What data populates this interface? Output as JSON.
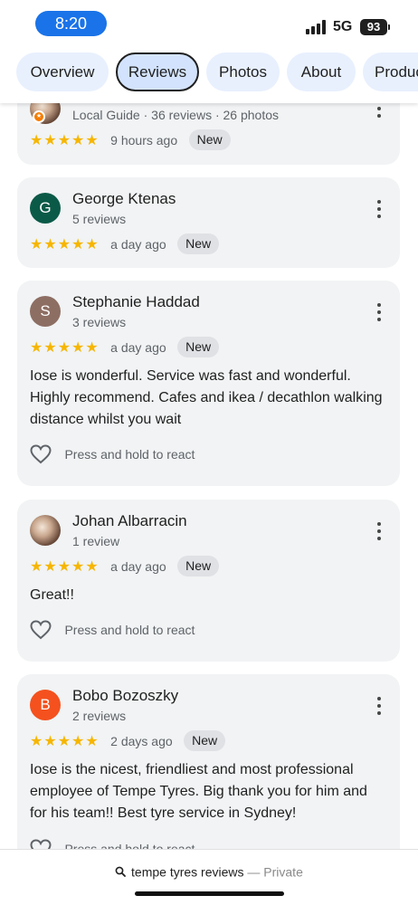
{
  "status_bar": {
    "time": "8:20",
    "network": "5G",
    "battery": "93"
  },
  "tabs": [
    {
      "label": "Overview",
      "active": false
    },
    {
      "label": "Reviews",
      "active": true
    },
    {
      "label": "Photos",
      "active": false
    },
    {
      "label": "About",
      "active": false
    },
    {
      "label": "Products",
      "active": false
    }
  ],
  "reviews": [
    {
      "name": "",
      "meta": "Local Guide · 36 reviews · 26 photos",
      "avatar_letter": "",
      "avatar_type": "photo",
      "rating": 5,
      "stars": "★★★★★",
      "time": "9 hours ago",
      "badge": "New",
      "text": "",
      "react_label": ""
    },
    {
      "name": "George Ktenas",
      "meta": "5 reviews",
      "avatar_letter": "G",
      "avatar_color": "#0b5a48",
      "rating": 5,
      "stars": "★★★★★",
      "time": "a day ago",
      "badge": "New",
      "text": "",
      "react_label": ""
    },
    {
      "name": "Stephanie Haddad",
      "meta": "3 reviews",
      "avatar_letter": "S",
      "avatar_color": "#8d6e63",
      "rating": 5,
      "stars": "★★★★★",
      "time": "a day ago",
      "badge": "New",
      "text": "Iose is wonderful. Service was fast and wonderful. Highly recommend. Cafes and ikea / decathlon walking distance whilst you wait",
      "react_label": "Press and hold to react"
    },
    {
      "name": "Johan Albarracin",
      "meta": "1 review",
      "avatar_letter": "",
      "avatar_type": "photo",
      "rating": 5,
      "stars": "★★★★★",
      "time": "a day ago",
      "badge": "New",
      "text": "Great!!",
      "react_label": "Press and hold to react"
    },
    {
      "name": "Bobo Bozoszky",
      "meta": "2 reviews",
      "avatar_letter": "B",
      "avatar_color": "#f4511e",
      "rating": 5,
      "stars": "★★★★★",
      "time": "2 days ago",
      "badge": "New",
      "text": "Iose is the nicest, friendliest and most professional employee of Tempe Tyres. Big thank you for him and for his team!! Best tyre service in Sydney!",
      "react_label": "Press and hold to react"
    }
  ],
  "bottom_bar": {
    "query": "tempe tyres reviews",
    "separator": " — ",
    "mode": "Private"
  },
  "icons": {
    "search": "search-icon",
    "more": "more-vert-icon",
    "heart": "heart-outline-icon",
    "signal": "signal-bars-icon",
    "battery": "battery-icon"
  },
  "colors": {
    "accent": "#1a73e8",
    "star": "#f6b600",
    "tab_bg": "#e8f0fe",
    "tab_active_bg": "#d3e3fd",
    "card_bg": "#f1f3f4"
  }
}
